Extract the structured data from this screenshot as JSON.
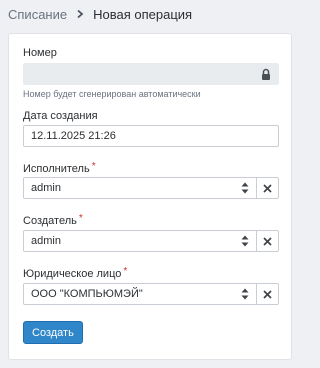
{
  "breadcrumb": {
    "parent": "Списание",
    "current": "Новая операция"
  },
  "form": {
    "number": {
      "label": "Номер",
      "value": "",
      "hint": "Номер будет сгенерирован автоматически"
    },
    "created_date": {
      "label": "Дата создания",
      "value": "12.11.2025 21:26"
    },
    "executor": {
      "label": "Исполнитель",
      "required_mark": "*",
      "value": "admin"
    },
    "creator": {
      "label": "Создатель",
      "required_mark": "*",
      "value": "admin"
    },
    "legal_entity": {
      "label": "Юридическое лицо",
      "required_mark": "*",
      "value": "ООО \"КОМПЬЮМЭЙ\""
    },
    "submit_label": "Создать"
  },
  "icons": {
    "breadcrumb_separator": "chevron-right-icon",
    "number_lock": "lock-icon",
    "select_arrows": "sort-arrows-icon",
    "clear": "close-icon"
  },
  "colors": {
    "primary_button": "#2f86c9",
    "required": "#d32f2f",
    "readonly_field": "#e9ecef"
  }
}
